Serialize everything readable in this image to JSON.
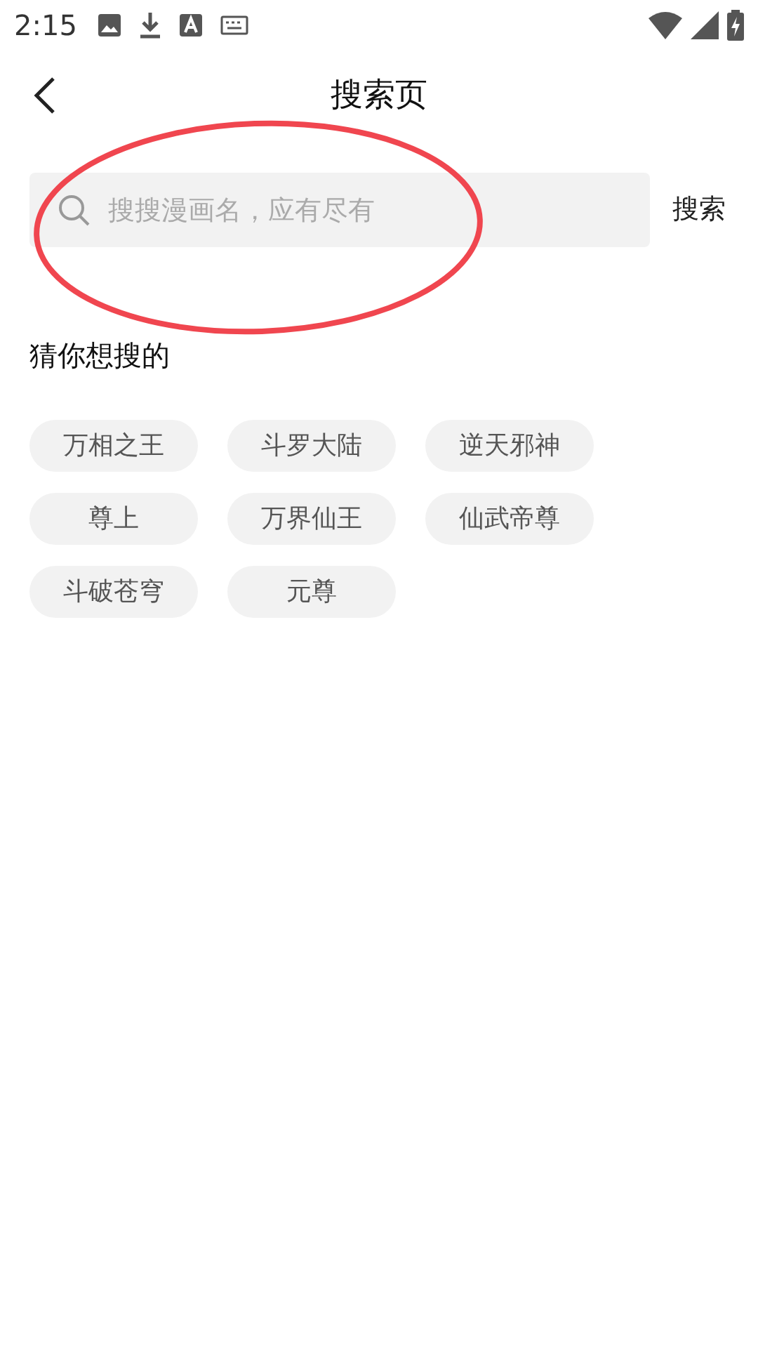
{
  "status_bar": {
    "time": "2:15"
  },
  "header": {
    "title": "搜索页"
  },
  "search": {
    "placeholder": "搜搜漫画名，应有尽有",
    "button": "搜索"
  },
  "suggestions": {
    "heading": "猜你想搜的",
    "tags": [
      "万相之王",
      "斗罗大陆",
      "逆天邪神",
      "尊上",
      "万界仙王",
      "仙武帝尊",
      "斗破苍穹",
      "元尊"
    ]
  }
}
